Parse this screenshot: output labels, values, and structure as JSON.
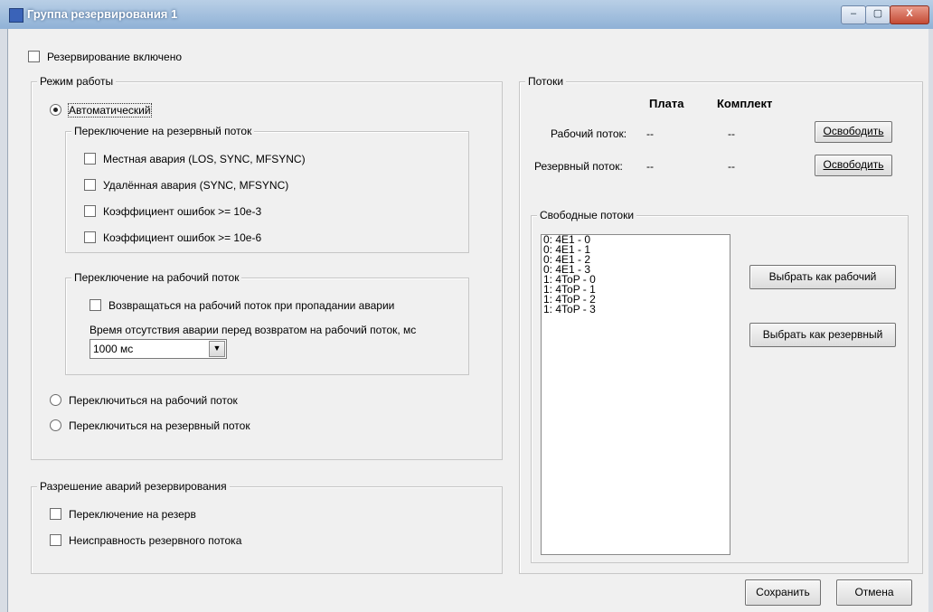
{
  "window": {
    "title": "Группа резервирования 1",
    "buttons": {
      "minimize": "–",
      "maximize": "▢",
      "close": "X"
    }
  },
  "backup_enabled": {
    "label": "Резервирование включено",
    "checked": false
  },
  "mode": {
    "legend": "Режим работы",
    "auto": {
      "label": "Автоматический",
      "selected": true
    },
    "switch_to_backup": {
      "legend": "Переключение на резервный поток",
      "items": [
        {
          "label": "Местная авария (LOS, SYNC, MFSYNC)",
          "checked": false
        },
        {
          "label": "Удалённая авария (SYNC, MFSYNC)",
          "checked": false
        },
        {
          "label": "Коэффициент ошибок >= 10e-3",
          "checked": false
        },
        {
          "label": "Коэффициент ошибок >= 10e-6",
          "checked": false
        }
      ]
    },
    "switch_to_work": {
      "legend": "Переключение на рабочий поток",
      "return_label": "Возвращаться на рабочий поток при пропадании аварии",
      "delay_label": "Время отсутствия аварии перед возвратом на рабочий поток, мс",
      "delay_value": "1000 мс"
    },
    "manual_work": {
      "label": "Переключиться на рабочий поток",
      "selected": false
    },
    "manual_backup": {
      "label": "Переключиться на резервный поток",
      "selected": false
    }
  },
  "alarms": {
    "legend": "Разрешение аварий резервирования",
    "items": [
      {
        "label": "Переключение на резерв",
        "checked": false
      },
      {
        "label": "Неисправность резервного потока",
        "checked": false
      }
    ]
  },
  "streams": {
    "legend": "Потоки",
    "headers": {
      "board": "Плата",
      "set": "Комплект"
    },
    "work": {
      "label": "Рабочий поток:",
      "board": "--",
      "set": "--",
      "button": "Освободить"
    },
    "backup": {
      "label": "Резервный поток:",
      "board": "--",
      "set": "--",
      "button": "Освободить"
    },
    "free": {
      "legend": "Свободные потоки",
      "items": [
        "0: 4E1 - 0",
        "0: 4E1 - 1",
        "0: 4E1 - 2",
        "0: 4E1 - 3",
        "1: 4ToP - 0",
        "1: 4ToP - 1",
        "1: 4ToP - 2",
        "1: 4ToP - 3"
      ],
      "select_work": "Выбрать как рабочий",
      "select_backup": "Выбрать как резервный"
    }
  },
  "footer": {
    "save": "Сохранить",
    "cancel": "Отмена"
  }
}
